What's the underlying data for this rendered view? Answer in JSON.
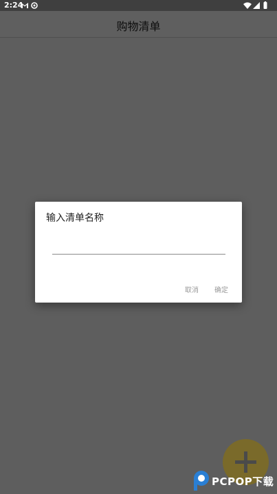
{
  "status_bar": {
    "time": "2:24",
    "icons": [
      "gmail-icon",
      "settings-icon",
      "wifi-icon",
      "signal-icon",
      "battery-icon"
    ]
  },
  "app_bar": {
    "title": "购物清单"
  },
  "dialog": {
    "title": "输入清单名称",
    "input_value": "",
    "cancel_label": "取消",
    "ok_label": "确定"
  },
  "fab": {
    "icon": "plus-icon"
  },
  "watermark": {
    "text": "PCPOP下载"
  },
  "colors": {
    "overlay": "#5e5e5e",
    "dialog_bg": "#ffffff",
    "fab": "#7a6a2a",
    "button_text": "#9a9a9a"
  }
}
